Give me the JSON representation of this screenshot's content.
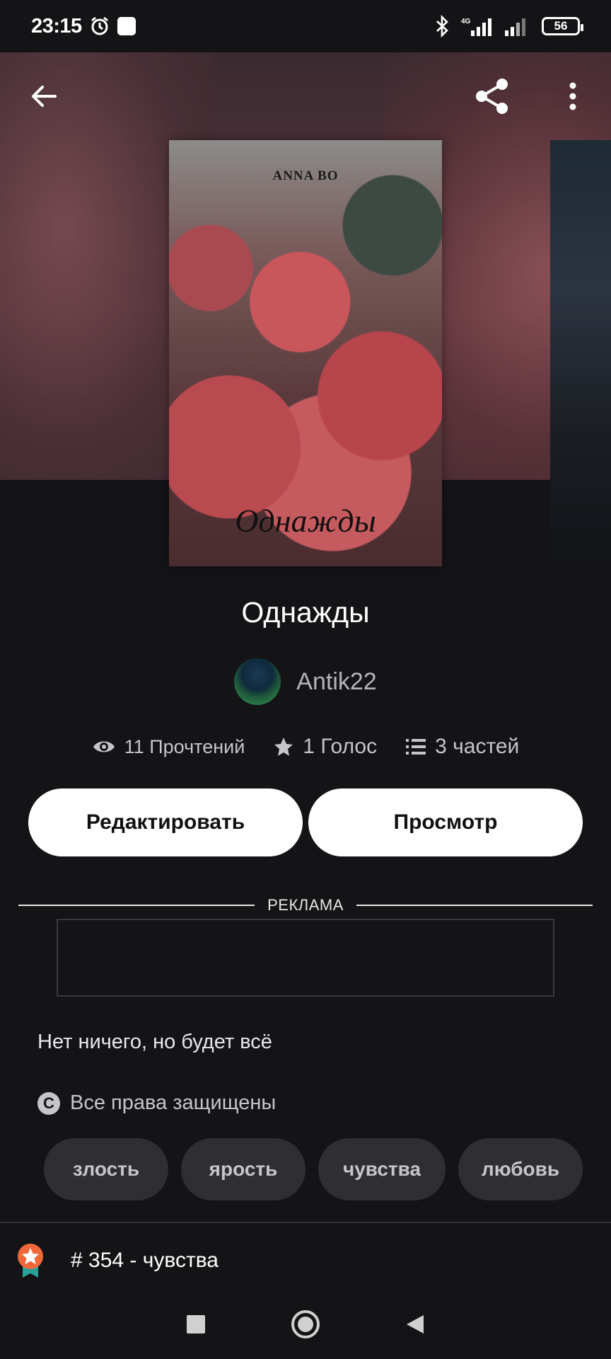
{
  "status_bar": {
    "time": "23:15",
    "network": "4G",
    "battery": "56"
  },
  "book": {
    "cover_author": "ANNA BO",
    "cover_title": "Однажды",
    "title": "Однажды",
    "author": "Antik22"
  },
  "stats": {
    "reads": "11 Прочтений",
    "votes": "1 Голос",
    "parts": "3 частей"
  },
  "actions": {
    "edit_label": "Редактировать",
    "view_label": "Просмотр"
  },
  "ad": {
    "label": "РЕКЛАМА"
  },
  "description": "Нет ничего, но будет всё",
  "copyright": "Все права защищены",
  "tags": [
    "злость",
    "ярость",
    "чувства",
    "любовь"
  ],
  "rank": {
    "text": "# 354 - чувства"
  },
  "colors": {
    "background": "#141316",
    "tag_background": "#2f2e32",
    "rank_badge": "#f0683a",
    "rank_ribbon": "#2aa198"
  },
  "icons": {
    "back": "arrow-left-icon",
    "share": "share-icon",
    "menu": "more-vertical-icon",
    "reads": "eye-icon",
    "votes": "star-icon",
    "parts": "list-icon",
    "copyright": "copyright-icon",
    "rank": "rank-badge-icon"
  }
}
